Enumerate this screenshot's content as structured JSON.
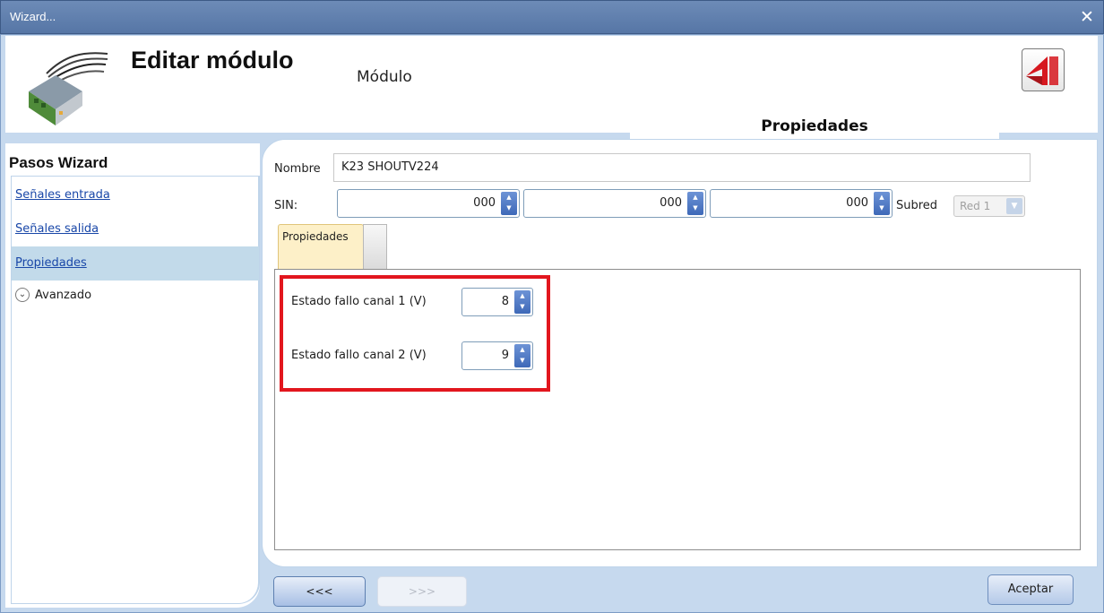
{
  "window": {
    "title": "Wizard...",
    "close_glyph": "✕"
  },
  "header": {
    "title": "Editar módulo",
    "subtitle": "Módulo",
    "tab": "Propiedades"
  },
  "sidebar": {
    "title": "Pasos Wizard",
    "items": [
      {
        "label": "Señales entrada"
      },
      {
        "label": "Señales salida"
      },
      {
        "label": "Propiedades",
        "selected": true
      },
      {
        "label": "Avanzado",
        "icon": "chevron-down-icon"
      }
    ]
  },
  "form": {
    "nombre_label": "Nombre",
    "nombre_value": "K23 SHOUTV224",
    "sin_label": "SIN:",
    "sin_values": [
      "000",
      "000",
      "000"
    ],
    "subred_label": "Subred",
    "subred_value": "Red 1",
    "inner_tab": "Propiedades",
    "fields": [
      {
        "label": "Estado fallo canal 1 (V)",
        "value": "8"
      },
      {
        "label": "Estado fallo canal 2 (V)",
        "value": "9"
      }
    ]
  },
  "footer": {
    "back": "<<<",
    "next": ">>>",
    "accept": "Aceptar"
  },
  "colors": {
    "titlebar": "#5676a6",
    "frame": "#c6d9ee",
    "highlight": "#e2161e",
    "link": "#1947a8",
    "selected": "#c2daea"
  },
  "icons": {
    "module": "module-device-icon",
    "logo": "app-logo-icon",
    "spin": "spinner-arrows-icon",
    "dropdown": "dropdown-arrow-icon"
  }
}
